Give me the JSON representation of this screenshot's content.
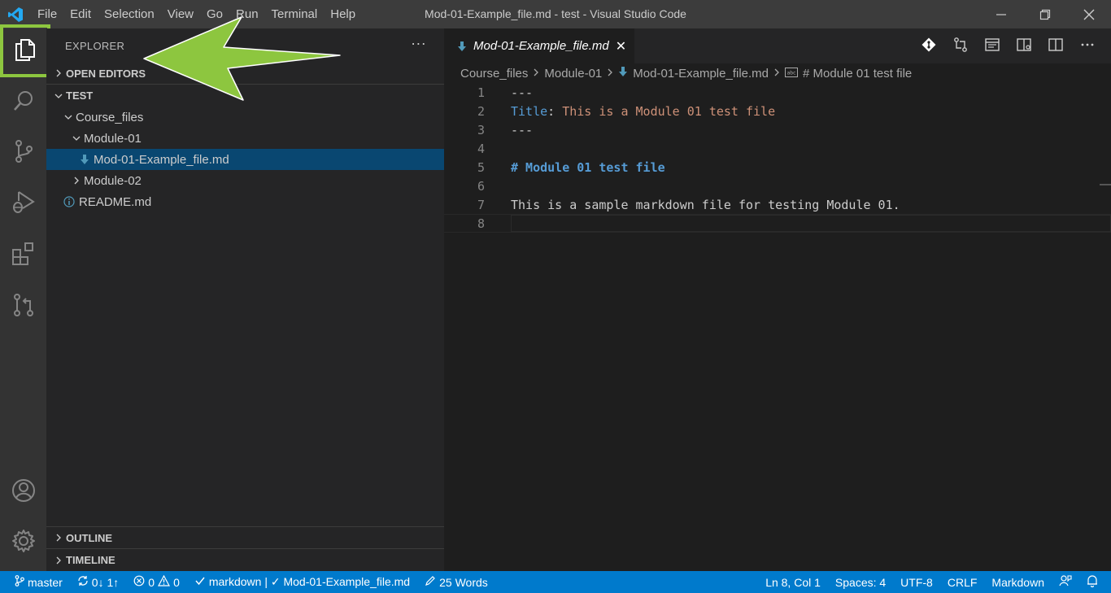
{
  "window": {
    "title": "Mod-01-Example_file.md - test - Visual Studio Code",
    "menu": [
      "File",
      "Edit",
      "Selection",
      "View",
      "Go",
      "Run",
      "Terminal",
      "Help"
    ]
  },
  "sidebar": {
    "title": "EXPLORER",
    "more": "···",
    "open_editors": "OPEN EDITORS",
    "workspace": "TEST",
    "tree": {
      "course_files": "Course_files",
      "module01": "Module-01",
      "selected_file": "Mod-01-Example_file.md",
      "module02": "Module-02",
      "readme": "README.md"
    },
    "outline": "OUTLINE",
    "timeline": "TIMELINE"
  },
  "editor": {
    "tab_label": "Mod-01-Example_file.md",
    "tab_close": "✕",
    "breadcrumb": [
      "Course_files",
      "Module-01",
      "Mod-01-Example_file.md",
      "# Module 01 test file"
    ],
    "lines": [
      {
        "n": "1",
        "text": "---"
      },
      {
        "n": "2",
        "key": "Title",
        "sep": ": ",
        "value": "This is a Module 01 test file"
      },
      {
        "n": "3",
        "text": "---"
      },
      {
        "n": "4",
        "text": ""
      },
      {
        "n": "5",
        "heading": "# Module 01 test file"
      },
      {
        "n": "6",
        "text": ""
      },
      {
        "n": "7",
        "text": "This is a sample markdown file for testing Module 01."
      },
      {
        "n": "8",
        "text": ""
      }
    ]
  },
  "status": {
    "branch": "master",
    "sync": "0↓ 1↑",
    "errors": "0",
    "warnings": "0",
    "lint": "markdown | ✓ Mod-01-Example_file.md",
    "words": "25 Words",
    "position": "Ln 8, Col 1",
    "spaces": "Spaces: 4",
    "encoding": "UTF-8",
    "eol": "CRLF",
    "language": "Markdown"
  },
  "colors": {
    "accent_annotation": "#8dc63f",
    "statusbar": "#007acc",
    "selection": "#094771",
    "md_key": "#569cd6",
    "md_value": "#ce9178",
    "md_heading": "#569cd6"
  }
}
